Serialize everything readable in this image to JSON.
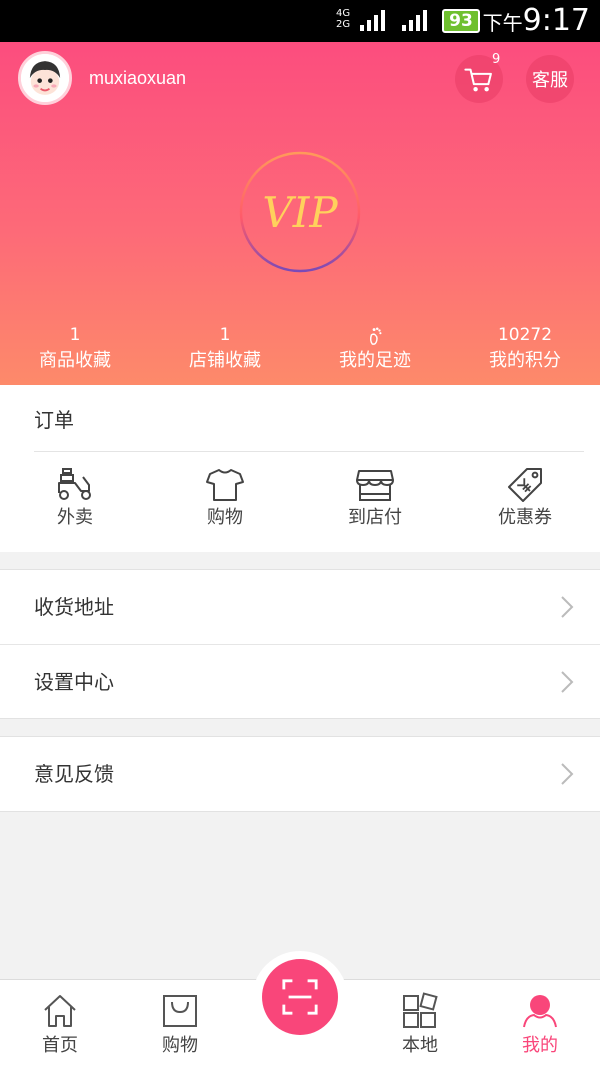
{
  "status_bar": {
    "network_top": "4G",
    "network_bottom": "2G",
    "battery": "93",
    "time_prefix": "下午",
    "time": "9:17"
  },
  "header": {
    "username": "muxiaoxuan",
    "cart_count": "9",
    "customer_service_label": "客服",
    "vip_label": "VIP",
    "stats": [
      {
        "value": "1",
        "label": "商品收藏"
      },
      {
        "value": "1",
        "label": "店铺收藏"
      },
      {
        "icon": "footprint-icon",
        "label": "我的足迹"
      },
      {
        "value": "10272",
        "label": "我的积分"
      }
    ]
  },
  "orders": {
    "title": "订单",
    "items": [
      {
        "label": "外卖",
        "icon": "scooter-icon"
      },
      {
        "label": "购物",
        "icon": "tshirt-icon"
      },
      {
        "label": "到店付",
        "icon": "store-icon"
      },
      {
        "label": "优惠券",
        "icon": "coupon-icon"
      }
    ]
  },
  "menu": {
    "group1": [
      {
        "label": "收货地址"
      },
      {
        "label": "设置中心"
      }
    ],
    "group2": [
      {
        "label": "意见反馈"
      }
    ]
  },
  "bottom_nav": {
    "items": [
      {
        "label": "首页",
        "icon": "home-icon"
      },
      {
        "label": "购物",
        "icon": "shopping-bag-icon"
      },
      {
        "label": "本地",
        "icon": "grid-icon"
      },
      {
        "label": "我的",
        "icon": "user-icon",
        "active": true
      }
    ],
    "center_icon": "scan-icon"
  },
  "colors": {
    "accent": "#f9467a",
    "header_top": "#fc4d7e",
    "header_bottom": "#fd8a6a",
    "battery": "#6fc02f"
  }
}
